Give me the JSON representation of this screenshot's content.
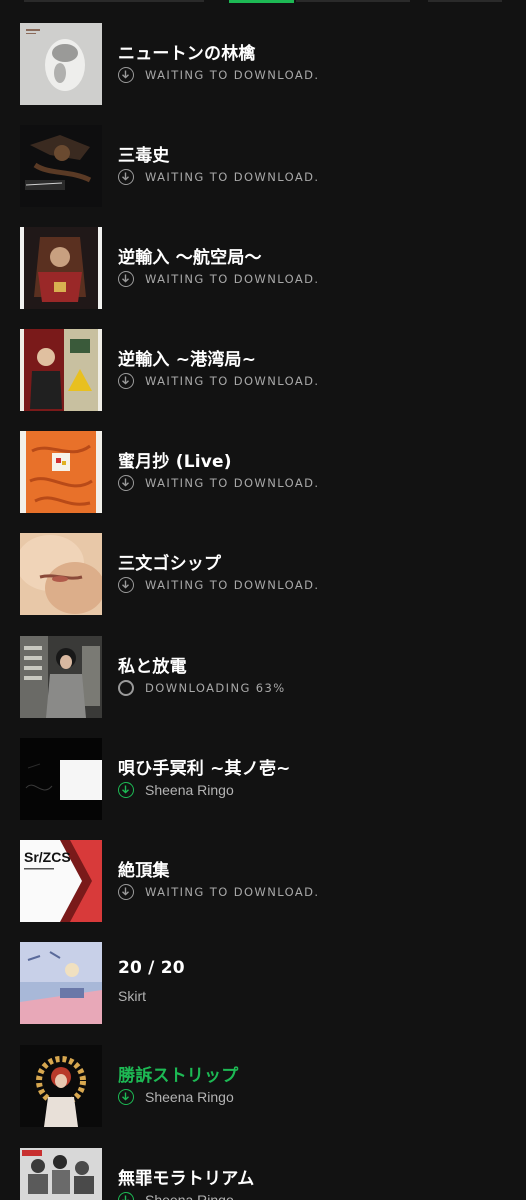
{
  "tabs": {
    "active_color": "#1db954"
  },
  "status_icons": {
    "waiting": "download-arrow-icon",
    "downloading": "progress-ring-icon",
    "downloaded": "downloaded-check-icon"
  },
  "tracks": [
    {
      "title": "ニュートンの林檎",
      "status": "WAITING TO DOWNLOAD.",
      "cover": "album-cover-newton"
    },
    {
      "title": "三毒史",
      "status": "WAITING TO DOWNLOAD.",
      "cover": "album-cover-sandokushi"
    },
    {
      "title": "逆輸入 〜航空局〜",
      "status": "WAITING TO DOWNLOAD.",
      "cover": "album-cover-gyakuyunyu-koukuu"
    },
    {
      "title": "逆輸入 ~港湾局~",
      "status": "WAITING TO DOWNLOAD.",
      "cover": "album-cover-gyakuyunyu-kouwan"
    },
    {
      "title": "蜜月抄 (Live)",
      "status": "WAITING TO DOWNLOAD.",
      "cover": "album-cover-mitsugetsu"
    },
    {
      "title": "三文ゴシップ",
      "status": "WAITING TO DOWNLOAD.",
      "cover": "album-cover-sanmon"
    },
    {
      "title": "私と放電",
      "status": "DOWNLOADING 63%",
      "progress": 0.63,
      "cover": "album-cover-watashi-to-houden"
    },
    {
      "title": "唄ひ手冥利 ~其ノ壱~",
      "artist": "Sheena Ringo",
      "cover": "album-cover-utaite"
    },
    {
      "title": "絶頂集",
      "status": "WAITING TO DOWNLOAD.",
      "cover": "album-cover-zecchoushuu"
    },
    {
      "title": "20 / 20",
      "artist": "Skirt",
      "cover": "album-cover-20-20"
    },
    {
      "title": "勝訴ストリップ",
      "artist": "Sheena Ringo",
      "cover": "album-cover-shouso",
      "highlight_color": "#1db954"
    },
    {
      "title": "無罪モラトリアム",
      "artist": "Sheena Ringo",
      "cover": "album-cover-muzai"
    }
  ]
}
